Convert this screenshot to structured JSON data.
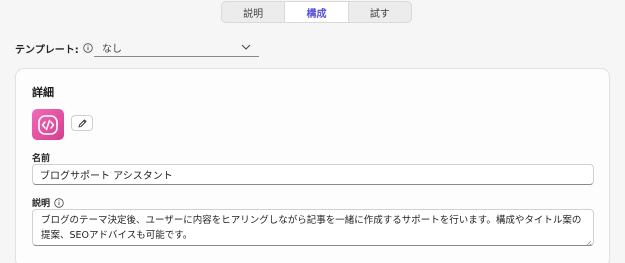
{
  "tabs": [
    {
      "label": "説明",
      "active": false
    },
    {
      "label": "構成",
      "active": true
    },
    {
      "label": "試す",
      "active": false
    }
  ],
  "template": {
    "label": "テンプレート:",
    "icon": "info-icon",
    "value": "なし",
    "dropdown_icon": "chevron-down-icon"
  },
  "details": {
    "title": "詳細",
    "app_icon": "code-brackets-icon",
    "edit_icon": "pencil-icon",
    "accent_color": "#e0559f"
  },
  "name_field": {
    "label": "名前",
    "value": "ブログサポート アシスタント"
  },
  "description_field": {
    "label": "説明",
    "icon": "info-icon",
    "value": "ブログのテーマ決定後、ユーザーに内容をヒアリングしながら記事を一緒に作成するサポートを行います。構成やタイトル案の提案、SEOアドバイスも可能です。"
  },
  "colors": {
    "active_tab": "#5a52d6",
    "background": "#f6f6f6"
  }
}
